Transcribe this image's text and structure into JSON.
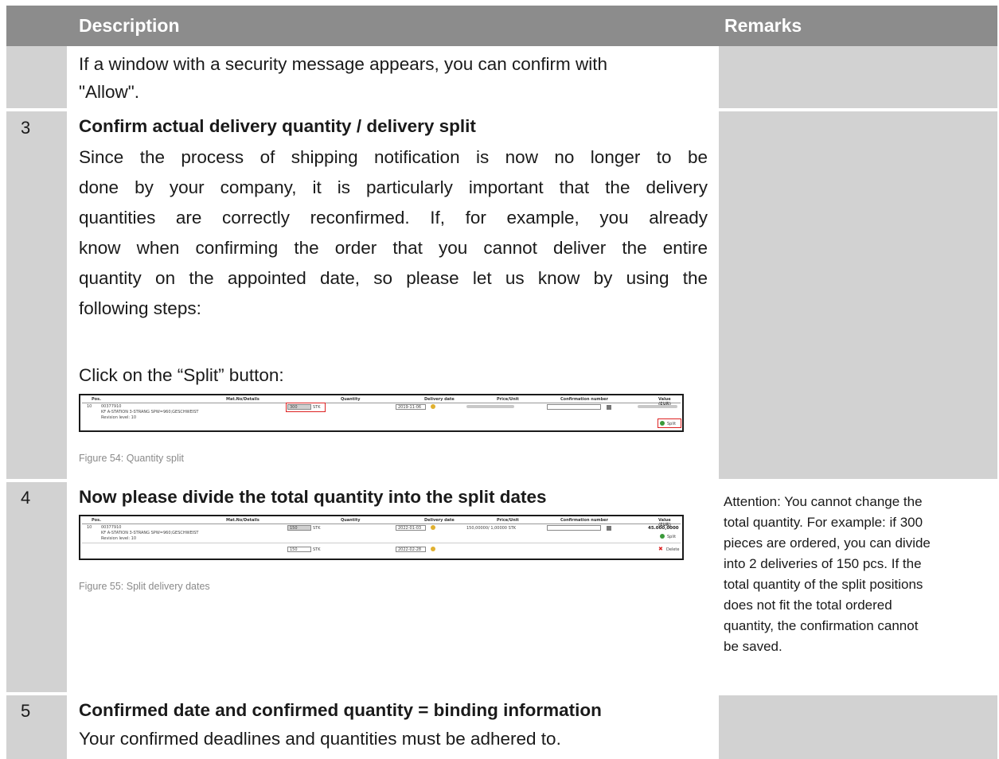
{
  "header": {
    "description": "Description",
    "remarks": "Remarks"
  },
  "row_cont": {
    "text_line1": "If a window with a security message appears, you can confirm with",
    "text_line2": "\"Allow\"."
  },
  "row3": {
    "number": "3",
    "title": "Confirm actual delivery quantity / delivery split",
    "para_lines": [
      "Since the process of shipping notification is now no longer to be",
      "done by your company, it is particularly important that the delivery",
      "quantities are correctly reconfirmed. If, for example, you already",
      "know when confirming the order that you cannot deliver the entire",
      "quantity on the appointed date, so please let us know by using the",
      "following steps:"
    ],
    "click_text": "Click on the “Split” button:",
    "caption": "Figure 54: Quantity split"
  },
  "row4": {
    "number": "4",
    "title": "Now please divide the total quantity into the split dates",
    "caption": "Figure 55: Split delivery dates",
    "remark_lines": [
      "Attention: You cannot change the",
      "total quantity. For example: if 300",
      "pieces are ordered, you can divide",
      "into 2 deliveries of 150 pcs. If the",
      "total quantity of the split positions",
      "does not fit the total ordered",
      "quantity, the confirmation cannot",
      "be saved."
    ]
  },
  "row5": {
    "number": "5",
    "title": "Confirmed date and confirmed quantity = binding information",
    "text": "Your confirmed deadlines and quantities must be adhered to."
  },
  "screenshot1": {
    "headers": [
      "Pos.",
      "Mat.No/Details",
      "Quantity",
      "Delivery date",
      "Price/Unit",
      "Confirmation number",
      "Value (EUR)"
    ],
    "pos": "10",
    "mat_no": "00377910",
    "mat_desc": "KF A-STATION 3-STRANG SPW=960;GESCHWEIST",
    "revision": "Revision level:  10",
    "qty": "300",
    "unit": "STK",
    "date": "2019-11-06",
    "split_label": "Split"
  },
  "screenshot2": {
    "headers": [
      "Pos.",
      "Mat.No/Details",
      "Quantity",
      "Delivery date",
      "Price/Unit",
      "Confirmation number",
      "Value (EUR)"
    ],
    "pos": "10",
    "mat_no": "00377910",
    "mat_desc": "KF A-STATION 3-STRANG SPW=960;GESCHWEIST",
    "revision": "Revision level:  10",
    "qty1": "150",
    "unit": "STK",
    "date1": "2022-01-03",
    "price": "150,00000/ 1,00000 STK",
    "value": "45.000,0000",
    "split_label": "Split",
    "qty2": "150",
    "date2": "2022-02-28",
    "delete_label": "Delete"
  }
}
